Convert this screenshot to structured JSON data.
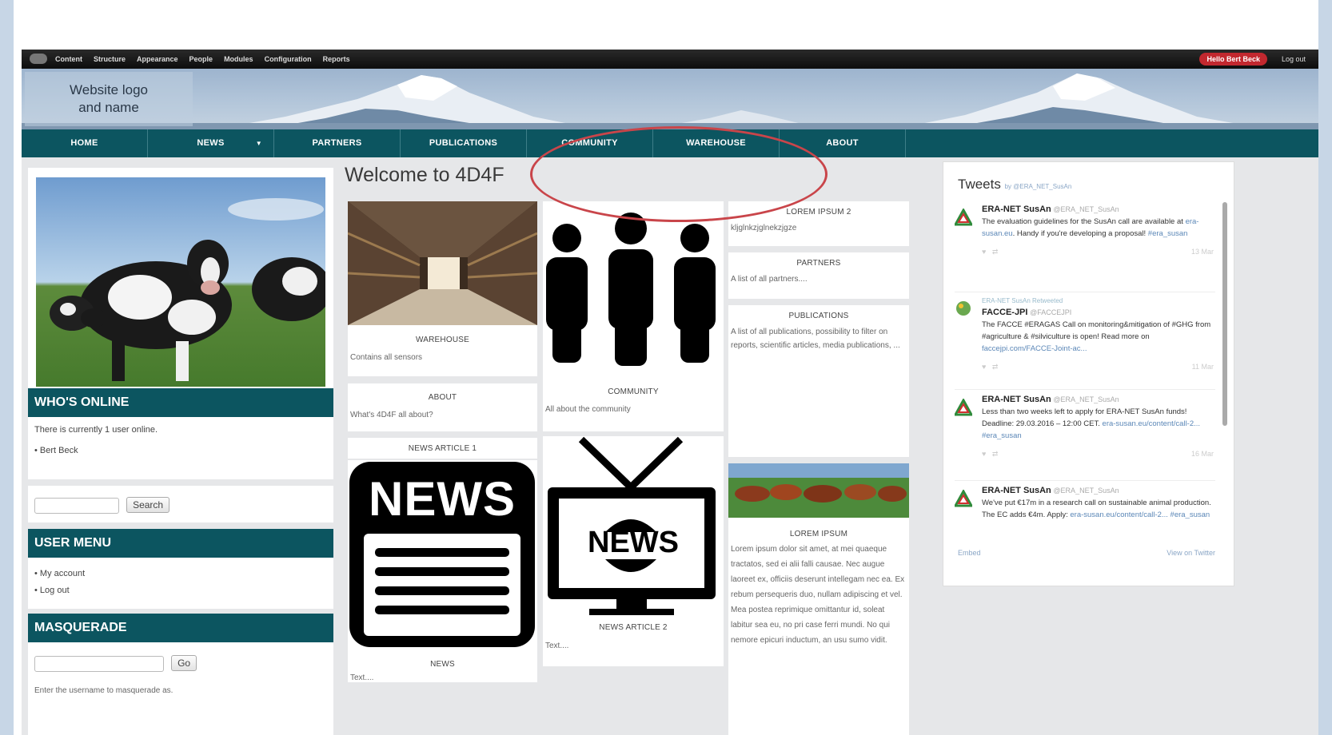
{
  "toolbar": {
    "items": [
      "Content",
      "Structure",
      "Appearance",
      "People",
      "Modules",
      "Configuration",
      "Reports"
    ],
    "hello": "Hello Bert Beck",
    "logout": "Log out"
  },
  "header": {
    "logo_line1": "Website logo",
    "logo_line2": "and name"
  },
  "nav": [
    "HOME",
    "NEWS",
    "PARTNERS",
    "PUBLICATIONS",
    "COMMUNITY",
    "WAREHOUSE",
    "ABOUT"
  ],
  "nav_dropdown_glyph": "▼",
  "left": {
    "whos_online": {
      "title": "WHO'S ONLINE",
      "text": "There is currently 1 user online.",
      "user": "Bert Beck"
    },
    "search_button": "Search",
    "user_menu": {
      "title": "USER MENU",
      "items": [
        "My account",
        "Log out"
      ]
    },
    "masquerade": {
      "title": "MASQUERADE",
      "button": "Go",
      "hint": "Enter the username to masquerade as."
    }
  },
  "main": {
    "welcome": "Welcome to 4D4F",
    "warehouse": {
      "title": "WAREHOUSE",
      "text": "Contains all sensors"
    },
    "about": {
      "title": "ABOUT",
      "text": "What's 4D4F all about?"
    },
    "community": {
      "title": "COMMUNITY",
      "text": "All about the community"
    },
    "news1": {
      "title": "NEWS ARTICLE 1",
      "badge": "NEWS",
      "label": "NEWS",
      "text": "Text...."
    },
    "news2": {
      "badge": "NEWS",
      "title": "NEWS ARTICLE 2",
      "text": "Text...."
    },
    "lorem2": {
      "title": "LOREM IPSUM 2",
      "text": "kljglnkzjglnekzjgze"
    },
    "partners": {
      "title": "PARTNERS",
      "text": "A list of all partners...."
    },
    "publications": {
      "title": "PUBLICATIONS",
      "text": "A list of all publications, possibility to filter on reports, scientific articles, media publications, ..."
    },
    "lorem": {
      "title": "LOREM IPSUM",
      "text": "Lorem ipsum dolor sit amet, at mei quaeque tractatos, sed ei alii falli causae. Nec augue laoreet ex, officiis deserunt intellegam nec ea. Ex rebum persequeris duo, nullam adipiscing et vel. Mea postea reprimique omittantur id, soleat labitur sea eu, no pri case ferri mundi. No qui nemore epicuri inductum, an usu sumo vidit."
    }
  },
  "tweets": {
    "title": "Tweets",
    "by": "by @ERA_NET_SusAn",
    "items": [
      {
        "name": "ERA-NET SusAn",
        "handle": "@ERA_NET_SusAn",
        "text": "The evaluation guidelines for the SusAn call are available at ",
        "link": "era-susan.eu",
        "text2": ". Handy if you're developing a proposal! ",
        "tag": "#era_susan",
        "time": "13 Mar"
      },
      {
        "retweet": "ERA-NET SusAn Retweeted",
        "name": "FACCE-JPI",
        "handle": "@FACCEJPI",
        "text": "The FACCE #ERAGAS Call on monitoring&mitigation of #GHG from #agriculture & #silviculture is open! Read more on ",
        "link": "faccejpi.com/FACCE-Joint-ac...",
        "time": "11 Mar"
      },
      {
        "name": "ERA-NET SusAn",
        "handle": "@ERA_NET_SusAn",
        "text": "Less than two weeks left to apply for ERA-NET SusAn funds! Deadline: 29.03.2016 – 12:00 CET. ",
        "link": "era-susan.eu/content/call-2...",
        "tag": "#era_susan",
        "time": "16 Mar"
      },
      {
        "name": "ERA-NET SusAn",
        "handle": "@ERA_NET_SusAn",
        "text": "We've put €17m in a research call on sustainable animal production. The EC adds €4m. Apply: ",
        "link": "era-susan.eu/content/call-2...",
        "tag": "#era_susan"
      }
    ],
    "embed": "Embed",
    "view": "View on Twitter"
  },
  "colors": {
    "teal": "#0c5560",
    "annotation_red": "#c9454a",
    "hello_red": "#c2282f"
  }
}
